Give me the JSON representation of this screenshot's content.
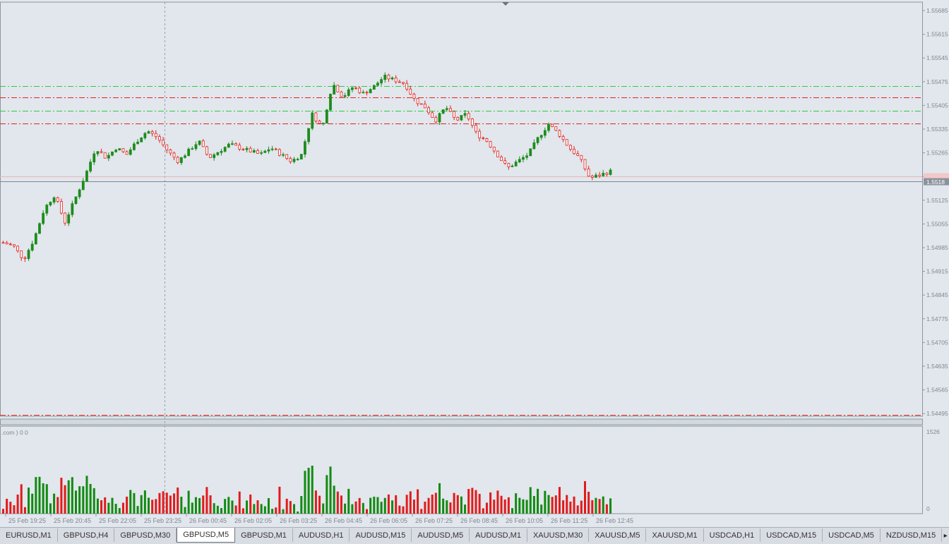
{
  "chart_data": {
    "type": "candlestick",
    "symbol": "GBPUSD",
    "timeframe": "M5",
    "price_labels": [
      "1.55685",
      "1.55615",
      "1.55545",
      "1.55475",
      "1.55405",
      "1.55335",
      "1.55265",
      "1.55195",
      "1.55125",
      "1.55055",
      "1.54985",
      "1.54915",
      "1.54845",
      "1.54775",
      "1.54705",
      "1.54635",
      "1.54565",
      "1.54495"
    ],
    "time_labels": [
      "25 Feb 19:25",
      "25 Feb 20:45",
      "25 Feb 22:05",
      "25 Feb 23:25",
      "26 Feb 00:45",
      "26 Feb 02:05",
      "26 Feb 03:25",
      "26 Feb 04:45",
      "26 Feb 06:05",
      "26 Feb 07:25",
      "26 Feb 08:45",
      "26 Feb 10:05",
      "26 Feb 11:25",
      "26 Feb 12:45"
    ],
    "current_price_label": "1.5518",
    "y_range": [
      1.5449,
      1.5569
    ],
    "horizontal_levels": [
      {
        "price": 1.55463,
        "color": "#2ecc40",
        "style": "dash-dot"
      },
      {
        "price": 1.55428,
        "color": "#e0241d",
        "style": "dash-dot"
      },
      {
        "price": 1.55389,
        "color": "#2ecc40",
        "style": "dash-dot"
      },
      {
        "price": 1.55352,
        "color": "#e0241d",
        "style": "dash-dot"
      },
      {
        "price": 1.54492,
        "color": "#e0241d",
        "style": "dash-dot"
      }
    ],
    "closes": [
      1.55,
      1.5499,
      1.5495,
      1.5501,
      1.551,
      1.5514,
      1.5506,
      1.5513,
      1.552,
      1.5528,
      1.5525,
      1.5528,
      1.5526,
      1.553,
      1.5533,
      1.5531,
      1.5527,
      1.5524,
      1.5527,
      1.553,
      1.5525,
      1.5527,
      1.5529,
      1.5528,
      1.5527,
      1.5526,
      1.5528,
      1.5526,
      1.5524,
      1.5526,
      1.5538,
      1.5534,
      1.5547,
      1.5543,
      1.5546,
      1.5544,
      1.5546,
      1.5549,
      1.5548,
      1.5547,
      1.5542,
      1.554,
      1.5536,
      1.554,
      1.5536,
      1.5538,
      1.5532,
      1.553,
      1.5526,
      1.5522,
      1.5524,
      1.5526,
      1.5531,
      1.5535,
      1.5532,
      1.5528,
      1.5525,
      1.5519,
      1.552,
      1.5521
    ],
    "indicator": {
      "label": ".com ) 0 0",
      "max_label": "1526",
      "min_label": "0"
    }
  },
  "tabs": [
    {
      "label": "EURUSD,M1",
      "active": false
    },
    {
      "label": "GBPUSD,H4",
      "active": false
    },
    {
      "label": "GBPUSD,M30",
      "active": false
    },
    {
      "label": "GBPUSD,M5",
      "active": true
    },
    {
      "label": "GBPUSD,M1",
      "active": false
    },
    {
      "label": "AUDUSD,H1",
      "active": false
    },
    {
      "label": "AUDUSD,M15",
      "active": false
    },
    {
      "label": "AUDUSD,M5",
      "active": false
    },
    {
      "label": "AUDUSD,M1",
      "active": false
    },
    {
      "label": "XAUUSD,M30",
      "active": false
    },
    {
      "label": "XAUUSD,M5",
      "active": false
    },
    {
      "label": "XAUUSD,M1",
      "active": false
    },
    {
      "label": "USDCAD,H1",
      "active": false
    },
    {
      "label": "USDCAD,M15",
      "active": false
    },
    {
      "label": "USDCAD,M5",
      "active": false
    },
    {
      "label": "NZDUSD,M15",
      "active": false
    }
  ],
  "tab_scroll_icon": "chevron-right-icon",
  "colors": {
    "bull": "#1c8c1c",
    "bear": "#e0241d",
    "background": "#e2e6ed",
    "grid": "#8f969e"
  }
}
